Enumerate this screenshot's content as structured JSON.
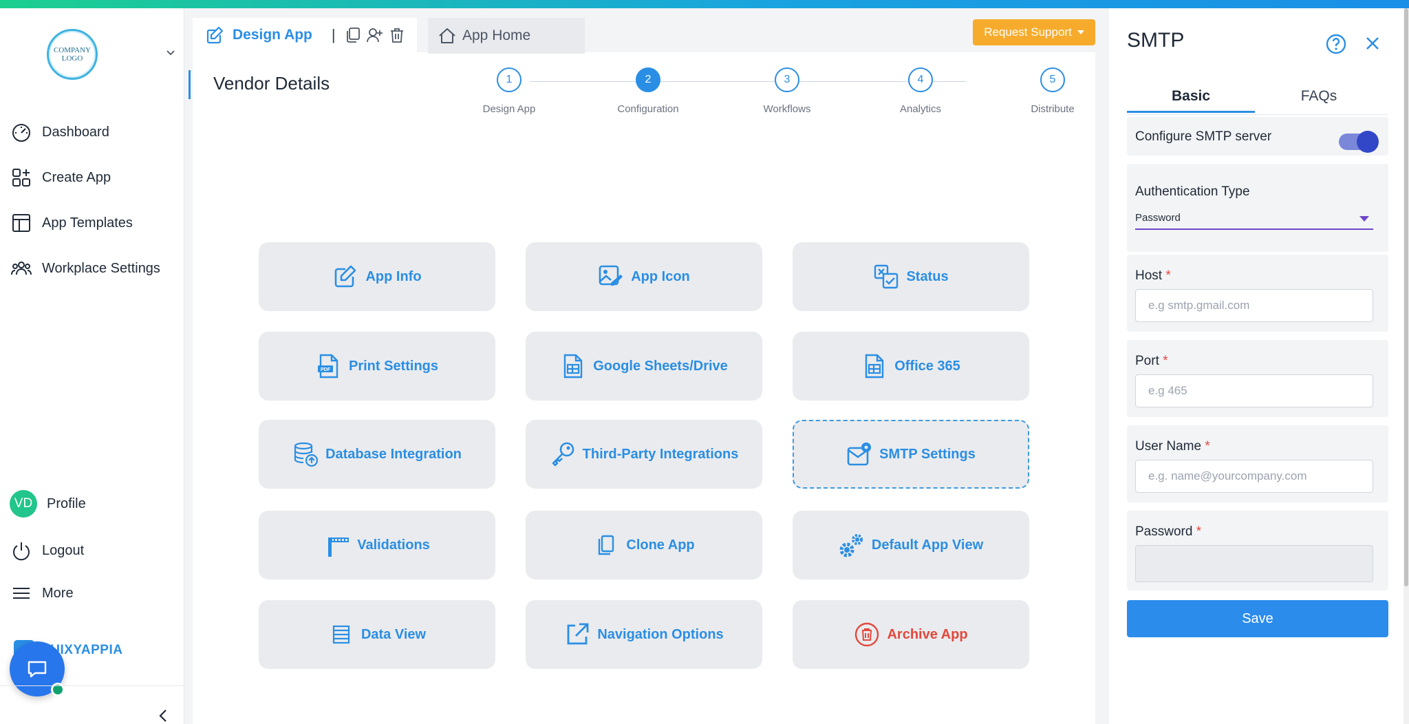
{
  "sidebar": {
    "logo_text": "COMPANY LOGO",
    "items": [
      {
        "label": "Dashboard",
        "icon": "gauge-icon"
      },
      {
        "label": "Create App",
        "icon": "grid-plus-icon"
      },
      {
        "label": "App Templates",
        "icon": "layout-icon"
      },
      {
        "label": "Workplace Settings",
        "icon": "people-icon"
      }
    ],
    "profile": {
      "initials": "VD",
      "label": "Profile"
    },
    "logout_label": "Logout",
    "more_label": "More",
    "brand_text": "QUIXYAPPIA"
  },
  "header": {
    "active_tab": "Design App",
    "separator": "|",
    "home_tab": "App Home",
    "support_button": "Request Support"
  },
  "main": {
    "page_title": "Vendor Details",
    "steps": [
      {
        "number": "1",
        "label": "Design App"
      },
      {
        "number": "2",
        "label": "Configuration"
      },
      {
        "number": "3",
        "label": "Workflows"
      },
      {
        "number": "4",
        "label": "Analytics"
      },
      {
        "number": "5",
        "label": "Distribute"
      }
    ],
    "active_step": 2,
    "cards": [
      {
        "label": "App Info",
        "icon": "edit-icon"
      },
      {
        "label": "App Icon",
        "icon": "image-edit-icon"
      },
      {
        "label": "Status",
        "icon": "status-icon"
      },
      {
        "label": "Print Settings",
        "icon": "pdf-icon"
      },
      {
        "label": "Google Sheets/Drive",
        "icon": "sheet-icon"
      },
      {
        "label": "Office 365",
        "icon": "sheet-icon"
      },
      {
        "label": "Database Integration",
        "icon": "database-icon"
      },
      {
        "label": "Third-Party Integrations",
        "icon": "key-icon"
      },
      {
        "label": "SMTP Settings",
        "icon": "mail-gear-icon"
      },
      {
        "label": "Validations",
        "icon": "barrier-icon"
      },
      {
        "label": "Clone App",
        "icon": "copy-icon"
      },
      {
        "label": "Default App View",
        "icon": "gears-icon"
      },
      {
        "label": "Data View",
        "icon": "list-icon"
      },
      {
        "label": "Navigation Options",
        "icon": "external-link-icon"
      },
      {
        "label": "Archive App",
        "icon": "trash-icon"
      }
    ],
    "selected_card": "SMTP Settings"
  },
  "panel": {
    "title": "SMTP",
    "tabs": [
      "Basic",
      "FAQs"
    ],
    "active_tab": "Basic",
    "configure_label": "Configure SMTP server",
    "configure_enabled": true,
    "auth_label": "Authentication Type",
    "auth_value": "Password",
    "host_label": "Host",
    "host_placeholder": "e.g smtp.gmail.com",
    "port_label": "Port",
    "port_placeholder": "e.g 465",
    "username_label": "User Name",
    "username_placeholder": "e.g. name@yourcompany.com",
    "password_label": "Password",
    "required_mark": "*",
    "save_label": "Save"
  },
  "colors": {
    "accent": "#2a8ee4",
    "warning": "#f7ab2c",
    "danger": "#e2483c",
    "toggle": "#3247c8"
  }
}
